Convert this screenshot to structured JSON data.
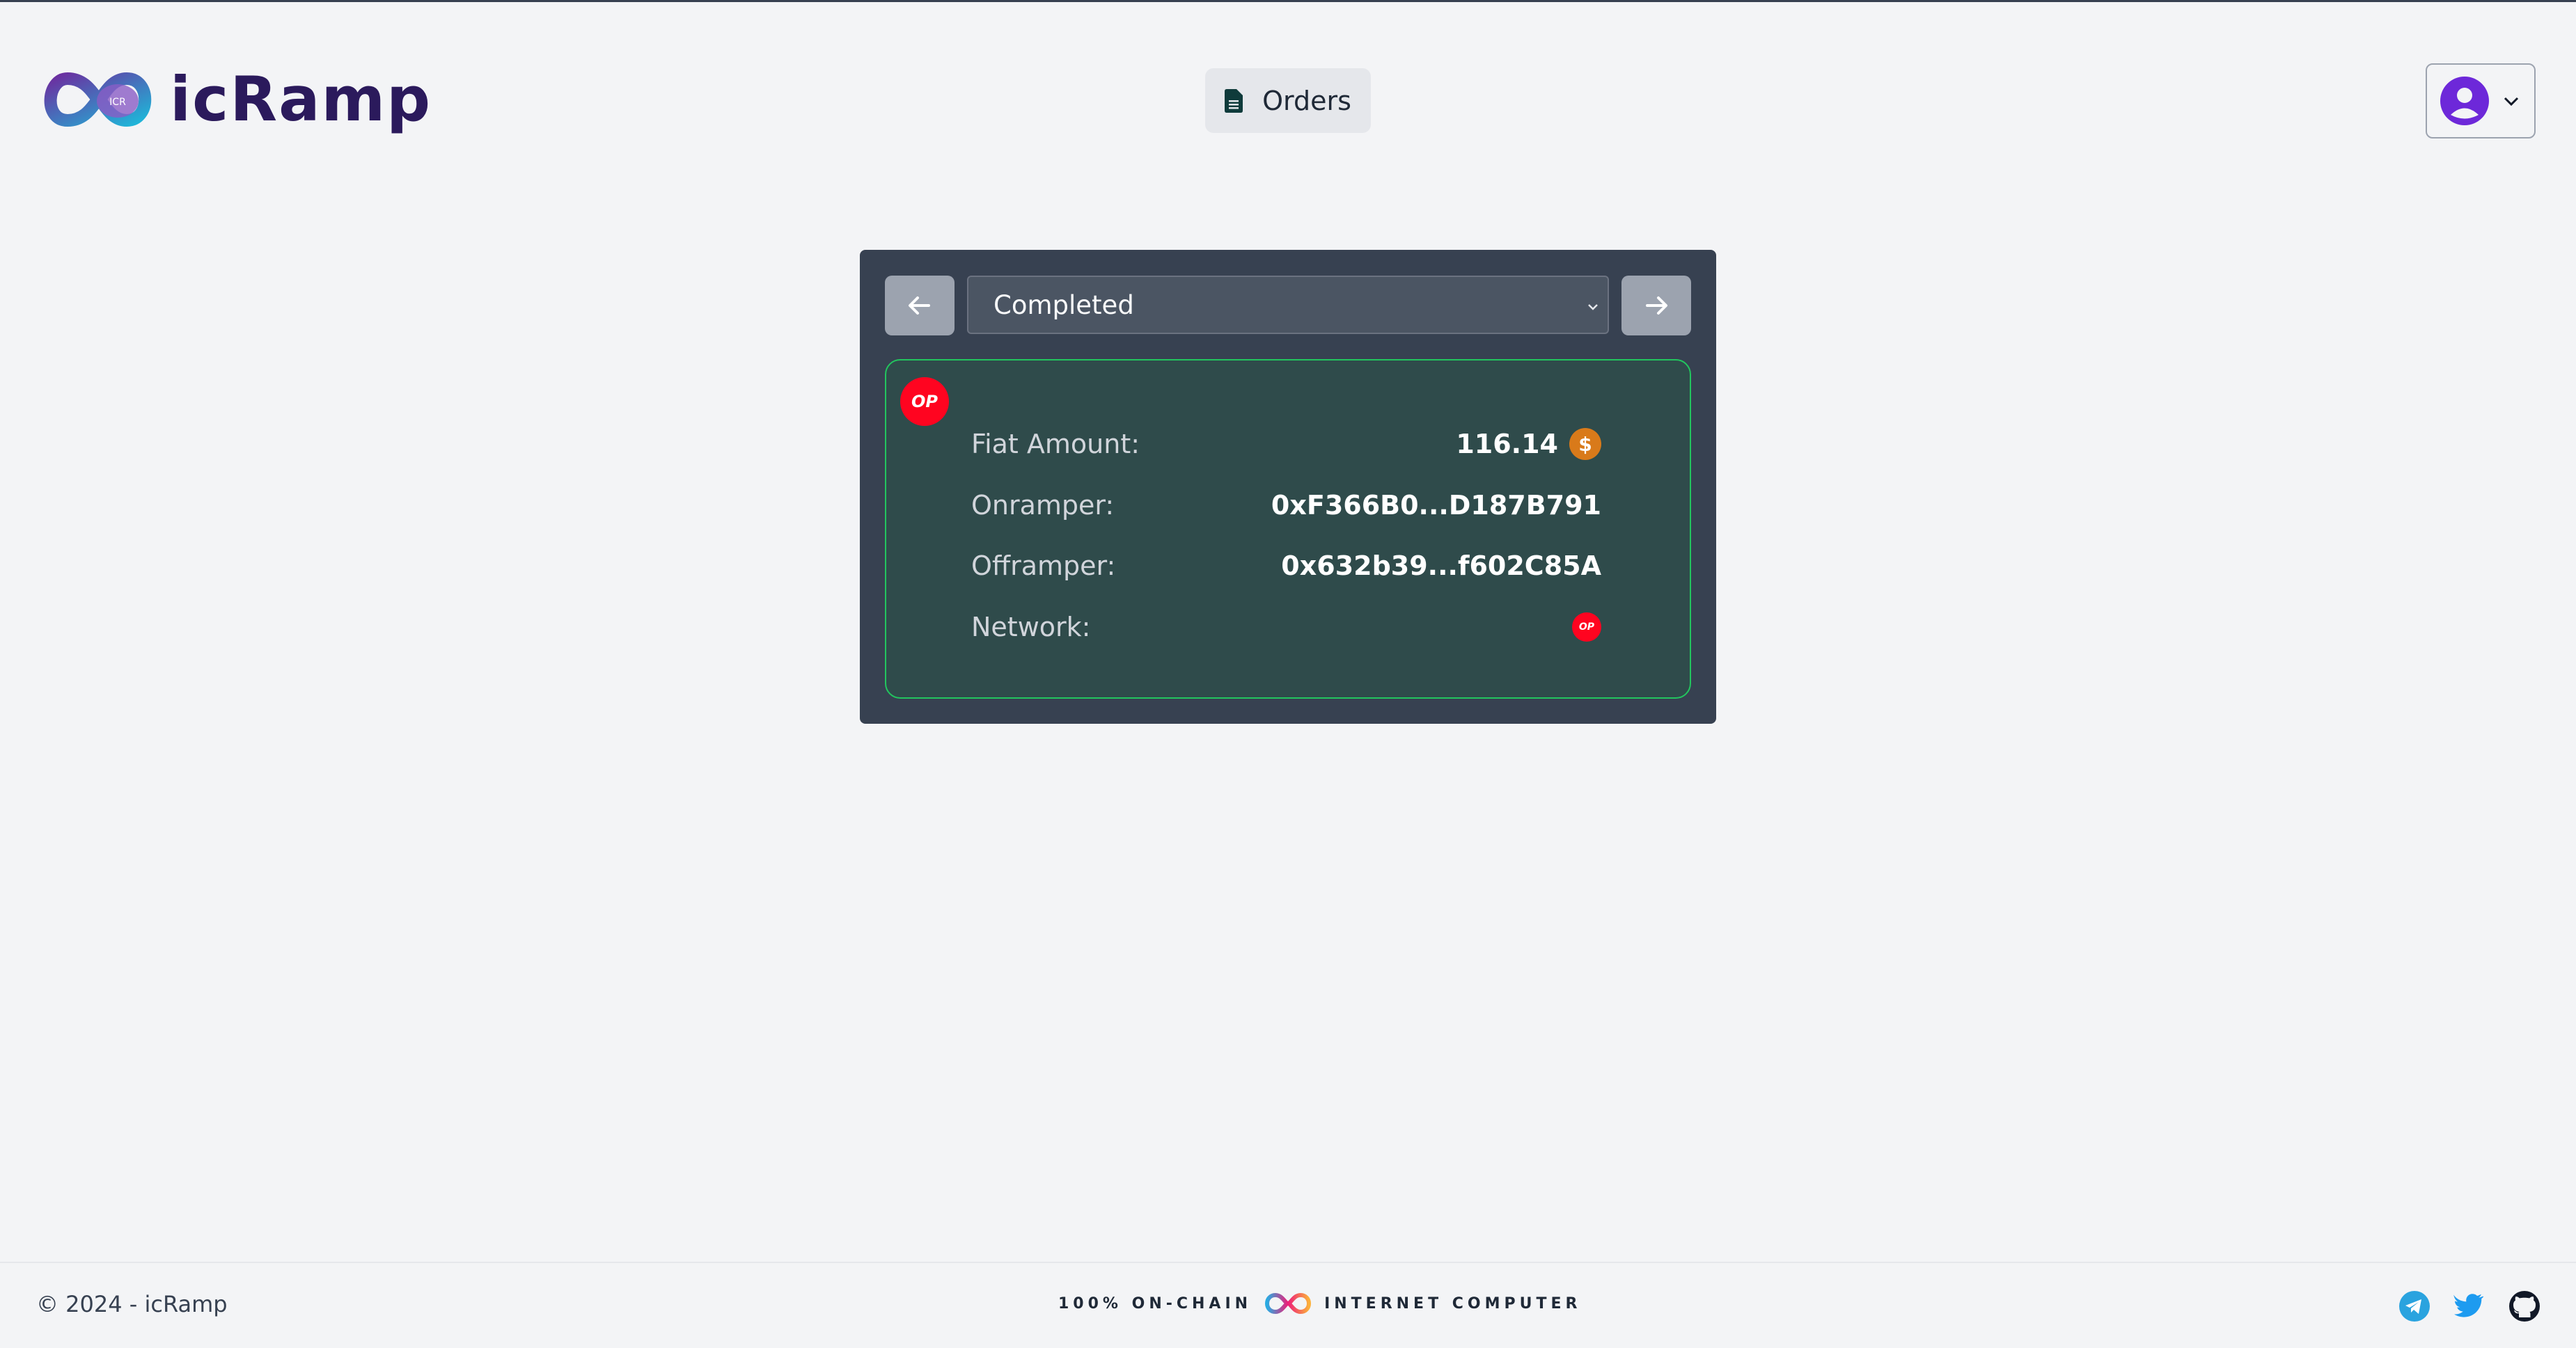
{
  "header": {
    "logo_text": "icRamp",
    "orders_label": "Orders"
  },
  "order_panel": {
    "status_filter": "Completed",
    "order": {
      "fiat_amount_label": "Fiat Amount:",
      "fiat_amount_value": "116.14",
      "onramper_label": "Onramper:",
      "onramper_value": "0xF366B0...D187B791",
      "offramper_label": "Offramper:",
      "offramper_value": "0x632b39...f602C85A",
      "network_label": "Network:",
      "network_badge": "OP"
    }
  },
  "footer": {
    "copyright": "© 2024 - icRamp",
    "onchain_left": "100% ON-CHAIN",
    "onchain_right": "INTERNET COMPUTER"
  },
  "colors": {
    "background": "#f3f4f6",
    "panel": "#374151",
    "card": "#2f4b4b",
    "card_border": "#22c55e",
    "op_red": "#ff0420",
    "brand_purple": "#2b1a5c"
  },
  "icons": {
    "logo": "infinity-logo-icon",
    "orders": "document-icon",
    "user": "user-avatar-icon",
    "prev": "arrow-left-icon",
    "next": "arrow-right-icon",
    "coin": "dollar-coin-icon",
    "telegram": "telegram-icon",
    "twitter": "twitter-icon",
    "github": "github-icon"
  }
}
